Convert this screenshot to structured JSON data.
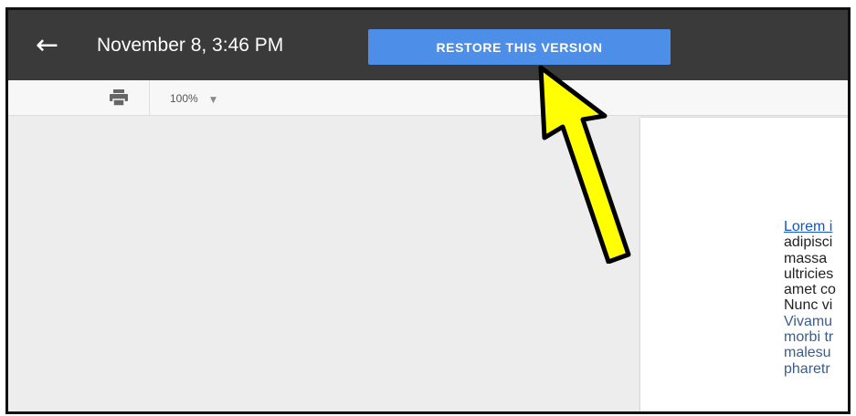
{
  "header": {
    "back_icon": "arrow-left-icon",
    "version_title": "November 8, 3:46 PM",
    "restore_label": "RESTORE THIS VERSION"
  },
  "toolbar": {
    "print_icon": "print-icon",
    "zoom_value": "100%",
    "zoom_caret_icon": "caret-down-icon"
  },
  "document": {
    "lines": [
      "Lorem i",
      "adipisci",
      "massa",
      "ultricies",
      "amet co",
      "Nunc vi",
      "Vivamu",
      "morbi tr",
      "malesu",
      "pharetr"
    ]
  },
  "colors": {
    "topbar": "#3a3a3a",
    "restore_button": "#4d8fe8",
    "annotation_arrow": "#ffff00"
  }
}
